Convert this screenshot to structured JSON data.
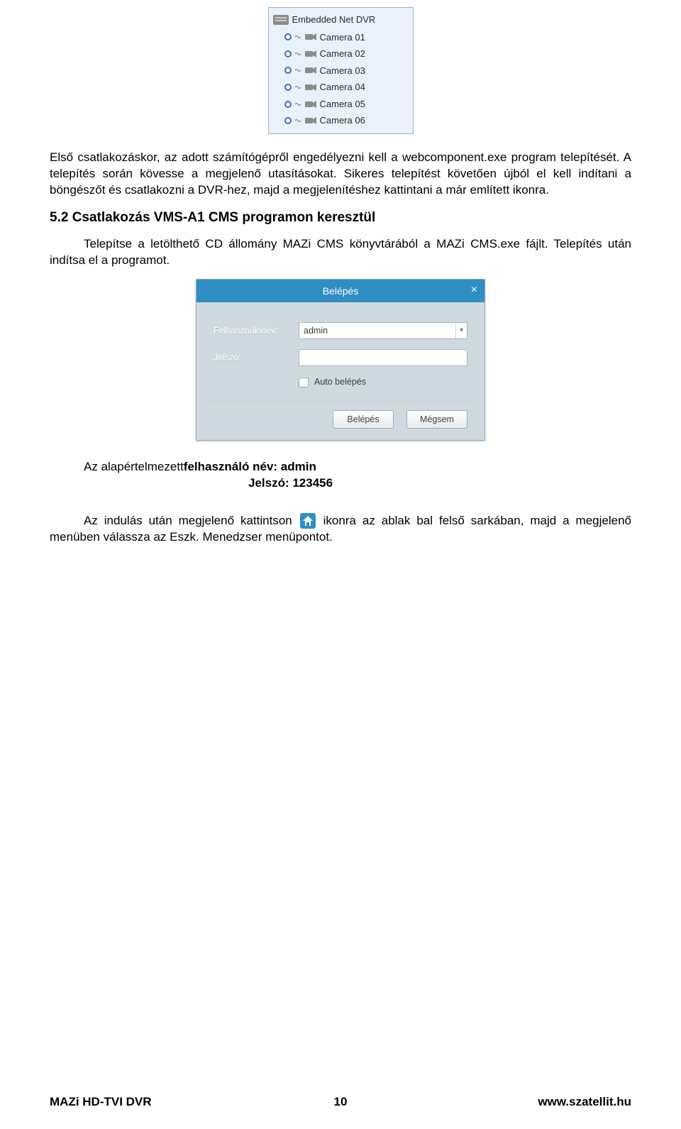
{
  "tree": {
    "root_label": "Embedded Net DVR",
    "cameras": [
      "Camera 01",
      "Camera 02",
      "Camera 03",
      "Camera 04",
      "Camera 05",
      "Camera 06"
    ]
  },
  "para1": "Első csatlakozáskor, az adott számítógépről engedélyezni kell a webcomponent.exe program telepítését. A telepítés során kövesse a megjelenő utasításokat. Sikeres telepítést követően újból el kell indítani a böngészőt és csatlakozni a DVR-hez, majd a megjelenítéshez kattintani a már említett ikonra.",
  "heading52": "5.2 Csatlakozás VMS-A1 CMS programon keresztül",
  "para2": "Telepítse a letölthető CD állomány MAZi CMS könyvtárából a MAZi CMS.exe fájlt. Telepítés után indítsa el a programot.",
  "login": {
    "title": "Belépés",
    "user_label": "Felhasználónév:",
    "user_value": "admin",
    "pass_label": "Jelszó:",
    "auto_label": "Auto belépés",
    "btn_ok": "Belépés",
    "btn_cancel": "Mégsem"
  },
  "cred": {
    "line1_plain": "Az alapértelmezett ",
    "line1_bold": "felhasználó név: admin",
    "line2_bold": "Jelszó: 123456"
  },
  "para3a": "Az indulás után megjelenő kattintson ",
  "para3b": " ikonra az ablak bal felső sarkában, majd a megjelenő menüben válassza az Eszk. Menedzser menüpontot.",
  "footer": {
    "left": "MAZi HD-TVI DVR",
    "center": "10",
    "right": "www.szatellit.hu"
  }
}
